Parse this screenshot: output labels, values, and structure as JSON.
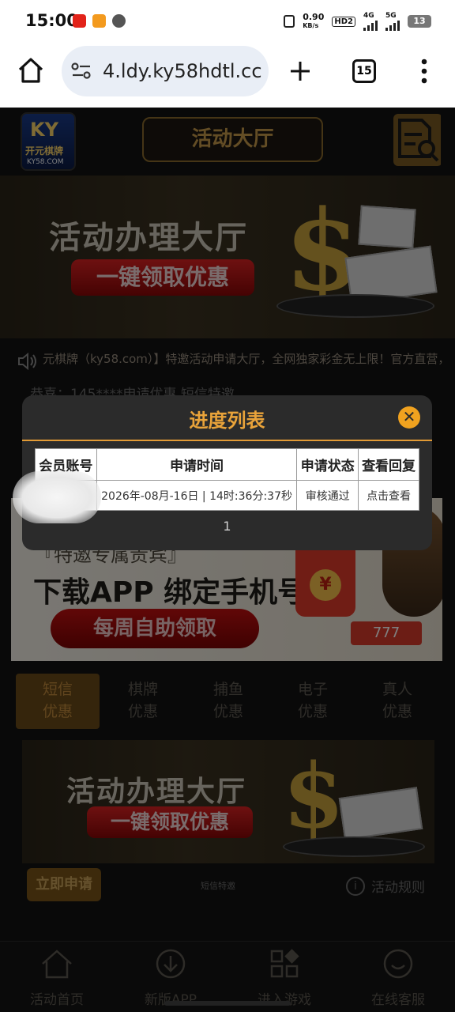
{
  "status_bar": {
    "time": "15:00",
    "net_speed": "0.90",
    "net_unit": "KB/s",
    "hd": "HD2",
    "net1": "4G",
    "net2": "5G",
    "battery": "13"
  },
  "browser": {
    "url": "4.ldy.ky58hdtl.cc",
    "tab_count": "15"
  },
  "header": {
    "logo_big": "KY",
    "logo_cn": "开元棋牌",
    "logo_domain": "KY58.COM",
    "title": "活动大厅"
  },
  "banner1": {
    "title": "活动办理大厅",
    "pill": "一键领取优惠"
  },
  "marquee": "元棋牌（ky58.com）】特邀活动申请大厅，全网独家彩金无上限！官方直营，",
  "congrats": "恭喜：145****申请优惠 短信特邀",
  "promo2": {
    "sub": "『特邀专属贵宾』",
    "title": "下载APP 绑定手机号",
    "button": "每周自助领取"
  },
  "tabs": [
    {
      "line1": "短信",
      "line2": "优惠"
    },
    {
      "line1": "棋牌",
      "line2": "优惠"
    },
    {
      "line1": "捕鱼",
      "line2": "优惠"
    },
    {
      "line1": "电子",
      "line2": "优惠"
    },
    {
      "line1": "真人",
      "line2": "优惠"
    }
  ],
  "banner2": {
    "title": "活动办理大厅",
    "pill": "一键领取优惠"
  },
  "actions": {
    "apply": "立即申请",
    "sms": "短信特邀",
    "rules": "活动规则"
  },
  "bottom_nav": [
    "活动首页",
    "新版APP",
    "进入游戏",
    "在线客服"
  ],
  "modal": {
    "title": "进度列表",
    "headers": [
      "会员账号",
      "申请时间",
      "申请状态",
      "查看回复"
    ],
    "row": {
      "account": "",
      "time": "2026年-08月-16日 | 14时:36分:37秒",
      "status": "审核通过",
      "action": "点击查看"
    },
    "page": "1"
  },
  "colors": {
    "accent": "#e9a33a",
    "status_ok": "#24a36a",
    "link_red": "#d01010"
  }
}
